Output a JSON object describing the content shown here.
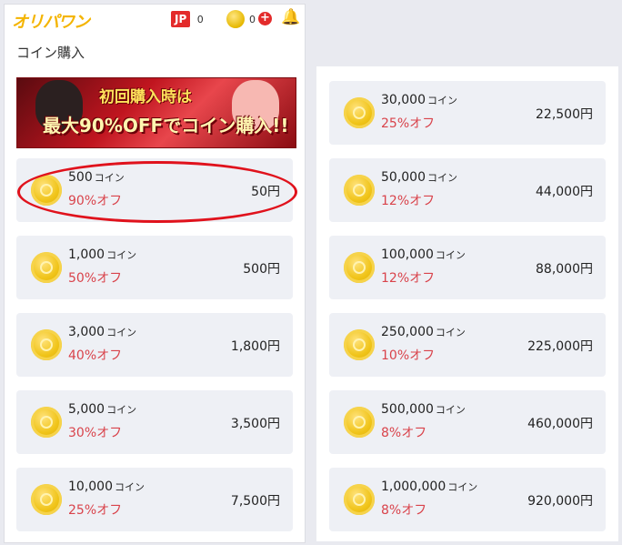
{
  "header": {
    "logo": "オリパワン",
    "jp_label": "JP",
    "jp_count": "0",
    "coin_count": "0",
    "plus": "+",
    "bell": "🔔"
  },
  "page_title": "コイン購入",
  "banner": {
    "line1": "初回購入時は",
    "line2": "最大90%OFFでコイン購入!!"
  },
  "coin_unit": "コイン",
  "currency": "円",
  "left_items": [
    {
      "amount": "500",
      "discount": "90%オフ",
      "price": "50円"
    },
    {
      "amount": "1,000",
      "discount": "50%オフ",
      "price": "500円"
    },
    {
      "amount": "3,000",
      "discount": "40%オフ",
      "price": "1,800円"
    },
    {
      "amount": "5,000",
      "discount": "30%オフ",
      "price": "3,500円"
    },
    {
      "amount": "10,000",
      "discount": "25%オフ",
      "price": "7,500円"
    }
  ],
  "right_items": [
    {
      "amount": "30,000",
      "discount": "25%オフ",
      "price": "22,500円"
    },
    {
      "amount": "50,000",
      "discount": "12%オフ",
      "price": "44,000円"
    },
    {
      "amount": "100,000",
      "discount": "12%オフ",
      "price": "88,000円"
    },
    {
      "amount": "250,000",
      "discount": "10%オフ",
      "price": "225,000円"
    },
    {
      "amount": "500,000",
      "discount": "8%オフ",
      "price": "460,000円"
    },
    {
      "amount": "1,000,000",
      "discount": "8%オフ",
      "price": "920,000円"
    }
  ],
  "colors": {
    "accent_red": "#e32b2b",
    "discount_red": "#d9434b",
    "logo_yellow": "#f4b400",
    "coin_gold": "#f0c419",
    "row_bg": "#eef0f5"
  }
}
